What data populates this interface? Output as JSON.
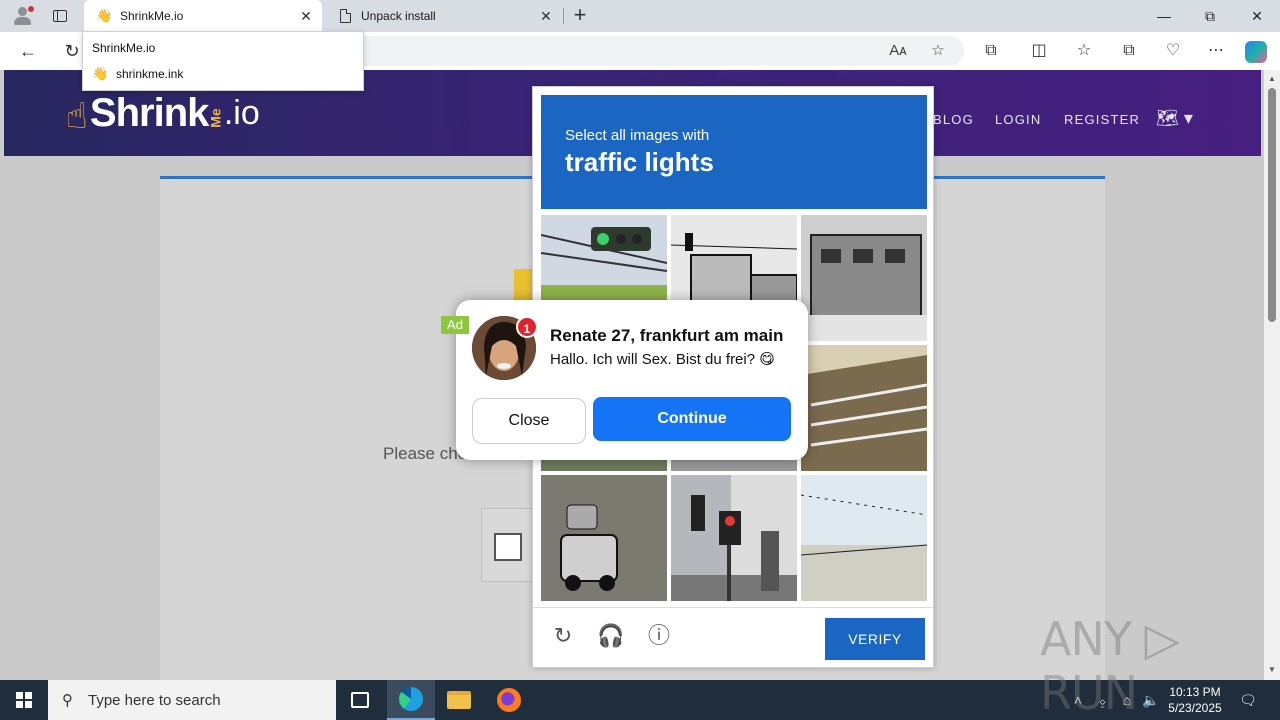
{
  "browser": {
    "tabs": [
      {
        "title": "ShrinkMe.io",
        "favicon": "waving-hand-emoji",
        "active": true
      },
      {
        "title": "Unpack install",
        "favicon": "document-icon",
        "active": false
      }
    ],
    "window_controls": {
      "minimize": "—",
      "restore": "⧉",
      "close": "✕"
    },
    "url_dropdown": {
      "header": "ShrinkMe.io",
      "suggestion": "shrinkme.ink"
    }
  },
  "site": {
    "logo": {
      "shrink": "Shrink",
      "me": "Me",
      "io": ".io"
    },
    "nav": [
      "BLOG",
      "LOGIN",
      "REGISTER"
    ],
    "please_text": "Please che"
  },
  "captcha": {
    "instruction": "Select all images with",
    "target": "traffic lights",
    "verify_label": "VERIFY",
    "icons": [
      "reload-icon",
      "audio-icon",
      "info-icon"
    ]
  },
  "ad": {
    "tag": "Ad",
    "badge_count": "1",
    "name": "Renate 27, frankfurt am main",
    "message": "Hallo. Ich will Sex. Bist du frei? 😋",
    "close_label": "Close",
    "continue_label": "Continue"
  },
  "watermark": "ANY ▷ RUN",
  "taskbar": {
    "search_placeholder": "Type here to search",
    "time": "10:13 PM",
    "date": "5/23/2025"
  },
  "colors": {
    "header_gradient_start": "#27275f",
    "header_gradient_end": "#461f80",
    "captcha_blue": "#1a66c2",
    "ad_button_blue": "#1474f5",
    "ad_tag_green": "#8dc63f"
  }
}
